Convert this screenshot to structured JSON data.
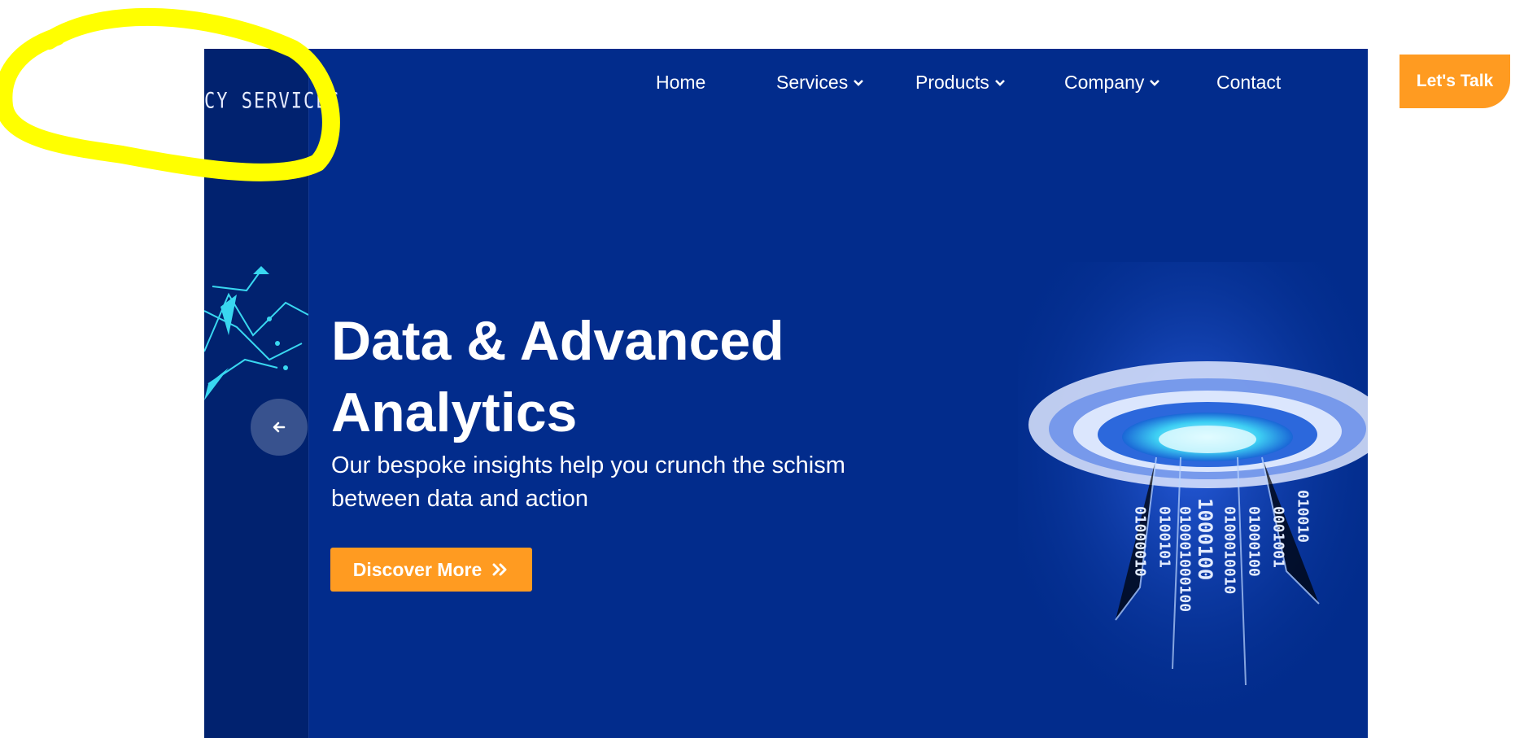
{
  "brand": {
    "logo_text": "CY SERVICES"
  },
  "nav": {
    "items": [
      {
        "label": "Home"
      },
      {
        "label": "Services"
      },
      {
        "label": "Products"
      },
      {
        "label": "Company"
      },
      {
        "label": "Contact"
      }
    ]
  },
  "header_cta": {
    "label": "Let's Talk"
  },
  "hero": {
    "headline_line1": "Data & Advanced",
    "headline_line2": "Analytics",
    "subtitle_line1": "Our bespoke insights help you crunch the schism",
    "subtitle_line2": "between data and action",
    "cta_label": "Discover More",
    "cta_icon": "double-chevron-right-icon",
    "prev_icon": "arrow-left-icon"
  },
  "colors": {
    "hero_bg": "#022c8c",
    "side_panel_bg": "#01226f",
    "accent": "#ff9b21",
    "highlight_stroke": "#ffff00"
  }
}
